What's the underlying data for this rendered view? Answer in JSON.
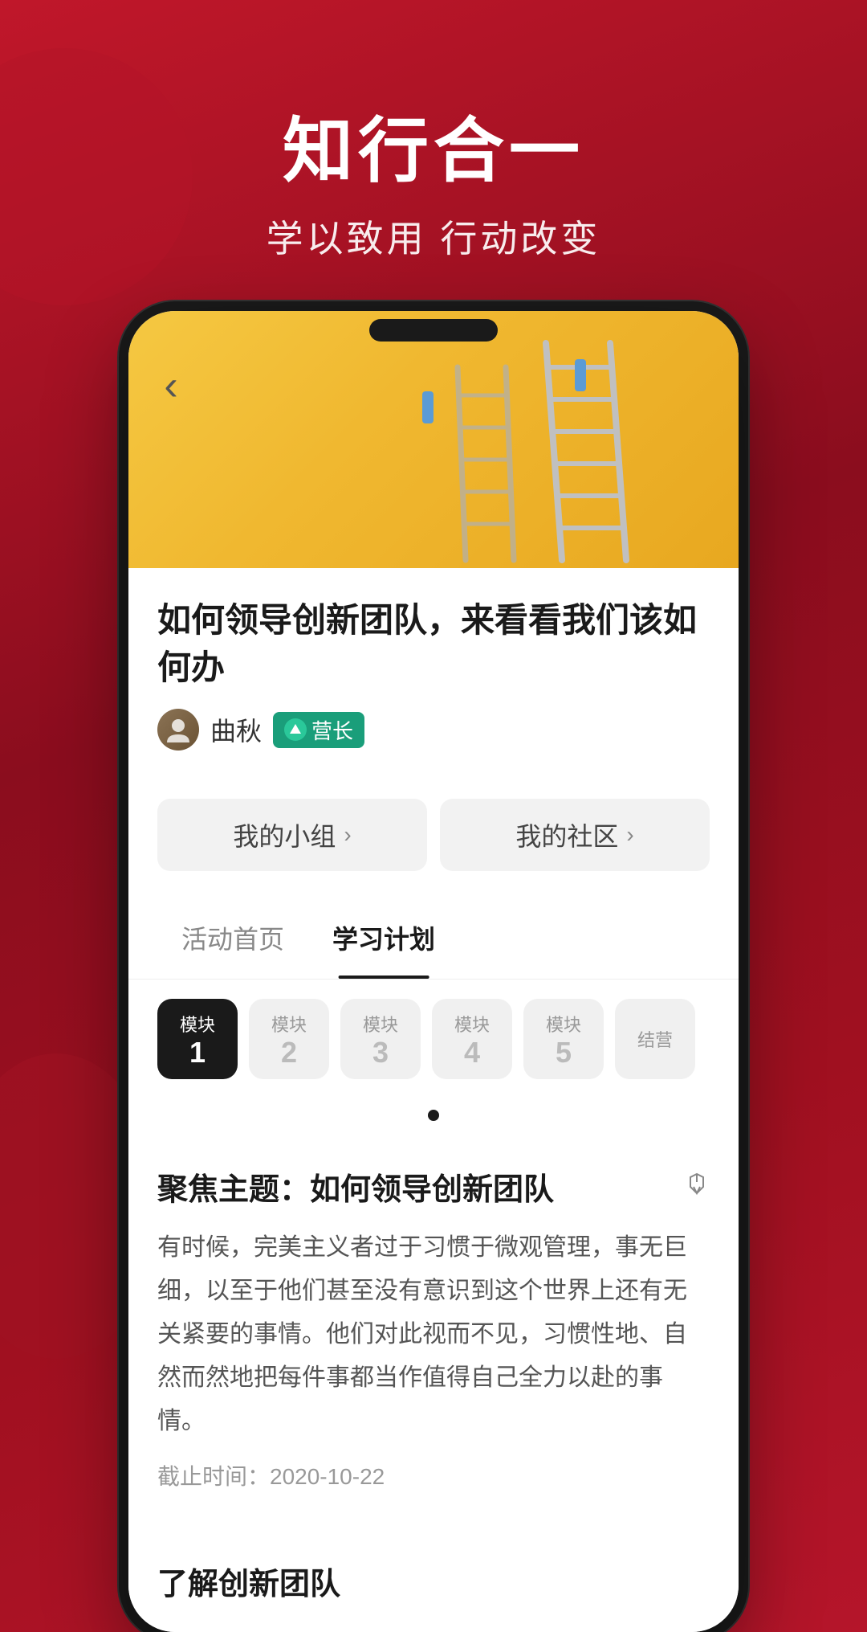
{
  "hero": {
    "title": "知行合一",
    "subtitle": "学以致用 行动改变"
  },
  "back_button": "‹",
  "article": {
    "title": "如何领导创新团队，来看看我们该如何办",
    "author_name": "曲秋",
    "badge_icon": "▲",
    "badge_text": "营长"
  },
  "nav_buttons": [
    {
      "label": "我的小组",
      "arrow": ">"
    },
    {
      "label": "我的社区",
      "arrow": ">"
    }
  ],
  "tabs": [
    {
      "label": "活动首页",
      "active": false
    },
    {
      "label": "学习计划",
      "active": true
    }
  ],
  "modules": [
    {
      "label": "模块",
      "num": "1",
      "active": true
    },
    {
      "label": "模块",
      "num": "2",
      "active": false
    },
    {
      "label": "模块",
      "num": "3",
      "active": false
    },
    {
      "label": "模块",
      "num": "4",
      "active": false
    },
    {
      "label": "模块",
      "num": "5",
      "active": false
    },
    {
      "label": "结营",
      "num": "",
      "active": false
    }
  ],
  "main_section": {
    "title": "聚焦主题：如何领导创新团队",
    "body": "有时候，完美主义者过于习惯于微观管理，事无巨细，以至于他们甚至没有意识到这个世界上还有无关紧要的事情。他们对此视而不见，习惯性地、自然而然地把每件事都当作值得自己全力以赴的事情。",
    "deadline": "截止时间：2020-10-22"
  },
  "sub_section": {
    "title": "了解创新团队"
  }
}
